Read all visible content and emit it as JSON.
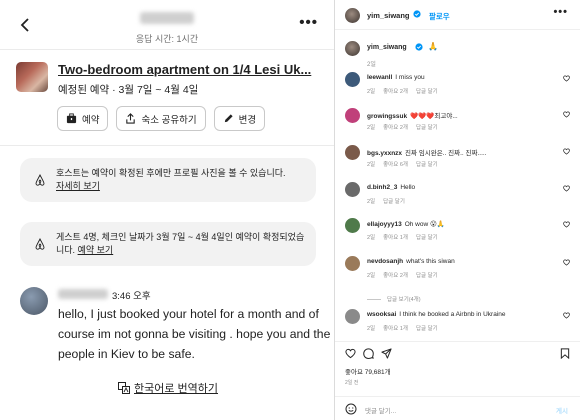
{
  "airbnb": {
    "header": {
      "response_time": "응답 시간: 1시간"
    },
    "listing": {
      "title": "Two-bedroom apartment on 1/4 Lesi Uk...",
      "subtitle": "예정된 예약 · 3월 7일 ~ 4월 4일",
      "buttons": [
        "예약",
        "숙소 공유하기",
        "변경"
      ]
    },
    "notices": [
      {
        "text": "호스트는 예약이 확정된 후에만 프로필 사진을 볼 수 있습니다.",
        "link": "자세히 보기"
      },
      {
        "text": "게스트 4명, 체크인 날짜가 3월 7일 ~ 4월 4일인 예약이 확정되었습니다.",
        "link": "예약 보기"
      }
    ],
    "message": {
      "time": "3:46 오후",
      "text": "hello, I just booked your hotel for a month and of course im not gonna be visiting . hope you and the people in Kiev to be safe."
    },
    "translate_label": "한국어로 번역하기"
  },
  "instagram": {
    "header": {
      "username": "yim_siwang",
      "follow_label": "팔로우"
    },
    "caption": {
      "username": "yim_siwang",
      "emoji": "🙏",
      "age": "2일"
    },
    "comments": [
      {
        "user": "leewanll",
        "text": "I miss you",
        "age": "2일",
        "likes": "좋아요 2개",
        "reply": "답글 달기",
        "avatar_color": "#3d5a7a"
      },
      {
        "user": "growingssuk",
        "text": "❤️❤️❤️최고야...",
        "age": "2일",
        "likes": "좋아요 2개",
        "reply": "답글 달기",
        "avatar_color": "#c0407a"
      },
      {
        "user": "bgs.yxxnzx",
        "text": "진짜 임시완은.. 진짜.. 진짜.....",
        "age": "2일",
        "likes": "좋아요 6개",
        "reply": "답글 달기",
        "avatar_color": "#7a5a4a"
      },
      {
        "user": "d.binh2_3",
        "text": "Hello",
        "age": "2일",
        "likes": "",
        "reply": "답글 달기",
        "avatar_color": "#6a6a6a"
      },
      {
        "user": "ellajoyyy13",
        "text": "Oh wow 😮🙏",
        "age": "2일",
        "likes": "좋아요 1개",
        "reply": "답글 달기",
        "avatar_color": "#4f7a4a"
      },
      {
        "user": "nevdosanjh",
        "text": "what's this siwan",
        "age": "2일",
        "likes": "좋아요 2개",
        "reply": "답글 달기",
        "avatar_color": "#9a7a5a",
        "replies_label": "답글 보기(4개)"
      },
      {
        "user": "wsooksai",
        "text": "I think he booked a Airbnb in Ukraine",
        "age": "2일",
        "likes": "좋아요 1개",
        "reply": "답글 달기",
        "avatar_color": "#8a8a8a"
      }
    ],
    "likes_count": "좋아요 79,681개",
    "post_age": "2일 전",
    "comment_placeholder": "댓글 달기...",
    "post_label": "게시",
    "accent_color": "#0095f6"
  }
}
